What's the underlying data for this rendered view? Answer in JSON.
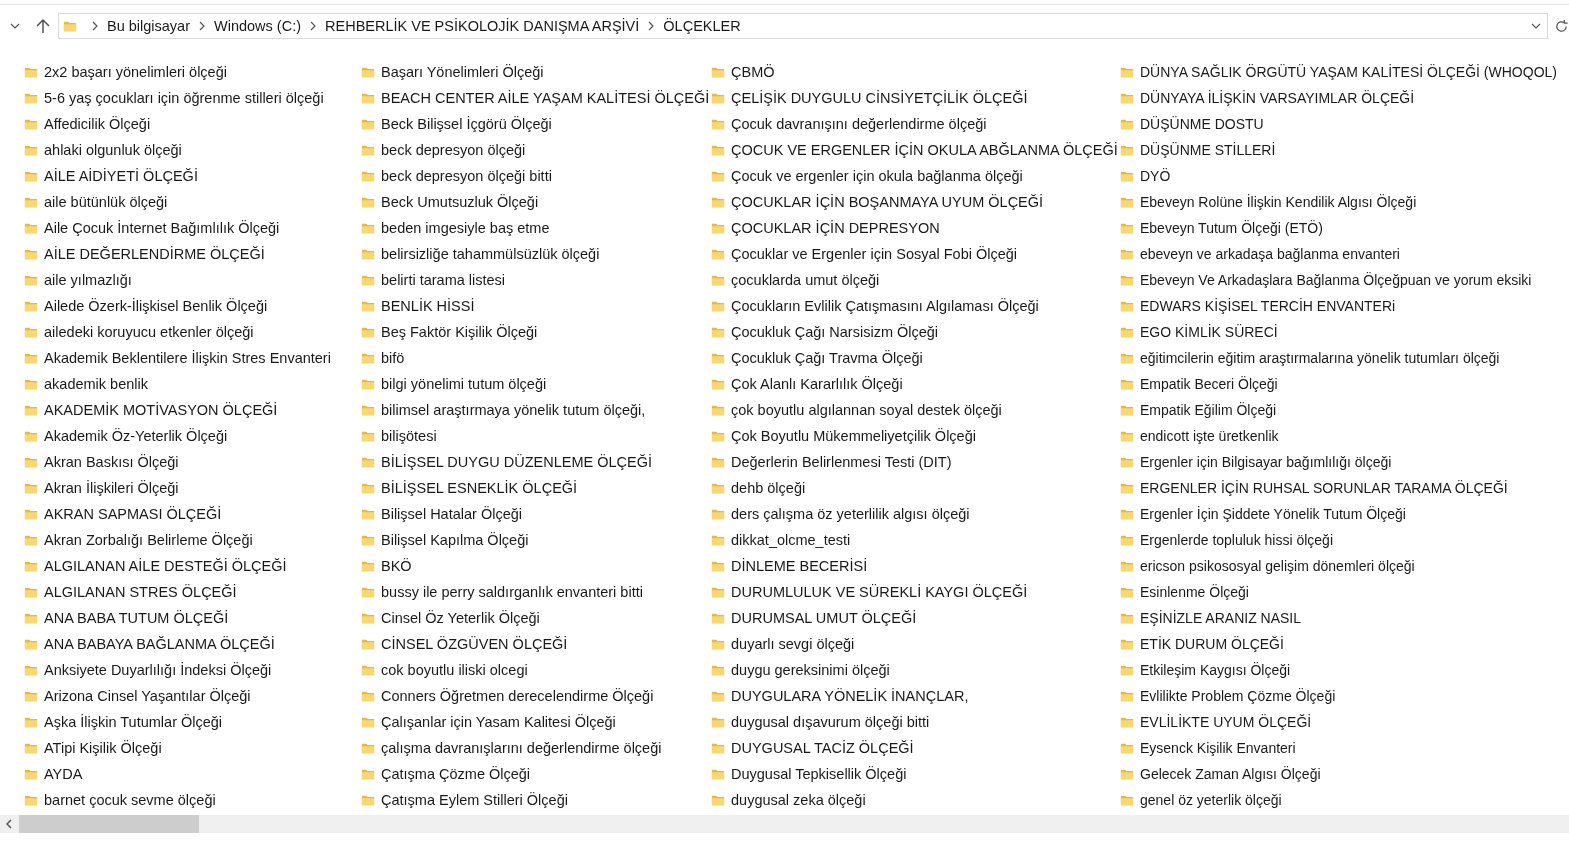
{
  "address_bar": {
    "breadcrumbs": [
      "Bu bilgisayar",
      "Windows (C:)",
      "REHBERLİK VE PSİKOLOJİK DANIŞMA ARŞİVİ",
      "ÖLÇEKLER"
    ]
  },
  "folder_columns": [
    [
      "2x2 başarı yönelimleri ölçeği",
      "5-6 yaş çocukları için öğrenme stilleri ölçeği",
      "Affedicilik Ölçeği",
      "ahlaki olgunluk ölçeği",
      "AİLE AİDİYETİ ÖLÇEĞİ",
      "aile bütünlük ölçeği",
      "Aile Çocuk İnternet Bağımlılık Ölçeği",
      "AİLE DEĞERLENDİRME ÖLÇEĞİ",
      "aile yılmazlığı",
      "Ailede Özerk-İlişkisel Benlik Ölçeği",
      "ailedeki koruyucu etkenler ölçeği",
      "Akademik Beklentilere İlişkin Stres Envanteri",
      "akademik benlik",
      "AKADEMİK MOTİVASYON ÖLÇEĞİ",
      "Akademik Öz-Yeterlik Ölçeği",
      "Akran Baskısı Ölçeği",
      "Akran İlişkileri Ölçeği",
      "AKRAN SAPMASI ÖLÇEĞİ",
      "Akran Zorbalığı Belirleme Ölçeği",
      "ALGILANAN AİLE DESTEĞİ ÖLÇEĞİ",
      "ALGILANAN STRES  ÖLÇEĞİ",
      "ANA BABA TUTUM ÖLÇEĞİ",
      "ANA BABAYA BAĞLANMA ÖLÇEĞİ",
      "Anksiyete Duyarlılığı İndeksi Ölçeği",
      "Arizona Cinsel Yaşantılar Ölçeği",
      "Aşka İlişkin Tutumlar Ölçeği",
      "ATipi Kişilik Ölçeği",
      "AYDA",
      "barnet çocuk sevme ölçeği"
    ],
    [
      "Başarı Yönelimleri Ölçeği",
      "BEACH CENTER AİLE YAŞAM KALİTESİ ÖLÇEĞİ",
      "Beck Bilişsel İçgörü Ölçeği",
      "beck depresyon ölçeği",
      "beck depresyon ölçeği bitti",
      "Beck Umutsuzluk Ölçeği",
      "beden imgesiyle baş etme",
      "belirsizliğe tahammülsüzlük ölçeği",
      "belirti tarama listesi",
      "BENLİK HİSSİ",
      "Beş Faktör Kişilik Ölçeği",
      "bifö",
      "bilgi yönelimi tutum ölçeği",
      "bilimsel araştırmaya yönelik tutum ölçeği,",
      "bilişötesi",
      "BİLİŞSEL DUYGU DÜZENLEME ÖLÇEĞİ",
      "BİLİŞSEL ESNEKLİK ÖLÇEĞİ",
      "Bilişsel Hatalar Ölçeği",
      "Bilişsel Kapılma Ölçeği",
      "BKÖ",
      "bussy ile perry saldırganlık envanteri bitti",
      "Cinsel Öz Yeterlik Ölçeği",
      "CİNSEL ÖZGÜVEN ÖLÇEĞİ",
      "cok boyutlu iliski olcegi",
      "Conners Öğretmen derecelendirme Ölçeği",
      "Çalışanlar için Yasam Kalitesi Ölçeği",
      "çalışma davranışlarını değerlendirme ölçeği",
      "Çatışma Çözme Ölçeği",
      "Çatışma Eylem Stilleri Ölçeği"
    ],
    [
      "ÇBMÖ",
      "ÇELİŞİK DUYGULU CİNSİYETÇİLİK ÖLÇEĞİ",
      "Çocuk davranışını değerlendirme ölçeği",
      "ÇOCUK VE ERGENLER İÇİN OKULA ABĞLANMA ÖLÇEĞİ",
      "Çocuk ve ergenler için okula bağlanma ölçeği",
      "ÇOCUKLAR İÇİN BOŞANMAYA UYUM ÖLÇEĞİ",
      "ÇOCUKLAR İÇİN DEPRESYON",
      "Çocuklar ve Ergenler için Sosyal Fobi Ölçeği",
      "çocuklarda umut ölçeği",
      "Çocukların Evlilik Çatışmasını Algılaması Ölçeği",
      "Çocukluk Çağı Narsisizm Ölçeği",
      "Çocukluk Çağı Travma Ölçeği",
      "Çok Alanlı Kararlılık Ölçeği",
      "çok boyutlu algılannan soyal destek ölçeği",
      "Çok Boyutlu Mükemmeliyetçilik Ölçeği",
      "Değerlerin Belirlenmesi Testi (DIT)",
      "dehb ölçeği",
      "ders çalışma öz yeterlilik algısı ölçeği",
      "dikkat_olcme_testi",
      "DİNLEME BECERİSİ",
      "DURUMLULUK VE SÜREKLİ KAYGI ÖLÇEĞİ",
      "DURUMSAL UMUT ÖLÇEĞİ",
      "duyarlı sevgi ölçeği",
      "duygu gereksinimi ölçeği",
      "DUYGULARA YÖNELİK İNANÇLAR,",
      "duygusal dışavurum ölçeği bitti",
      "DUYGUSAL TACİZ ÖLÇEĞİ",
      "Duygusal Tepkisellik Ölçeği",
      "duygusal zeka ölçeği"
    ],
    [
      "DÜNYA SAĞLIK ÖRGÜTÜ YAŞAM KALİTESİ ÖLÇEĞİ (WHOQOL)",
      "DÜNYAYA İLİŞKİN VARSAYIMLAR ÖLÇEĞİ",
      "DÜŞÜNME DOSTU",
      "DÜŞÜNME STİLLERİ",
      "DYÖ",
      "Ebeveyn Rolüne İlişkin Kendilik Algısı Ölçeği",
      "Ebeveyn Tutum Ölçeği (ETÖ)",
      "ebeveyn ve arkadaşa bağlanma envanteri",
      "Ebeveyn Ve Arkadaşlara Bağlanma Ölçeğpuan ve yorum eksiki",
      "EDWARS KİŞİSEL TERCİH ENVANTERi",
      "EGO KİMLİK SÜRECİ",
      "eğitimcilerin eğitim araştırmalarına yönelik tutumları ölçeği",
      "Empatik Beceri Ölçeği",
      "Empatik Eğilim Ölçeği",
      "endicott işte üretkenlik",
      "Ergenler için Bilgisayar bağımlılığı ölçeği",
      "ERGENLER İÇİN RUHSAL SORUNLAR TARAMA ÖLÇEĞİ",
      "Ergenler İçin Şiddete Yönelik Tutum Ölçeği",
      "Ergenlerde topluluk hissi ölçeği",
      "ericson psikososyal gelişim dönemleri ölçeği",
      "Esinlenme Ölçeği",
      "EŞİNİZLE ARANIZ NASIL",
      "ETİK DURUM ÖLÇEĞİ",
      "Etkileşim Kaygısı Ölçeği",
      "Evlilikte Problem Çözme Ölçeği",
      "EVLİLİKTE UYUM ÖLÇEĞİ",
      "Eysenck Kişilik Envanteri",
      "Gelecek Zaman Algısı Ölçeği",
      "genel öz yeterlik ölçeği"
    ]
  ]
}
